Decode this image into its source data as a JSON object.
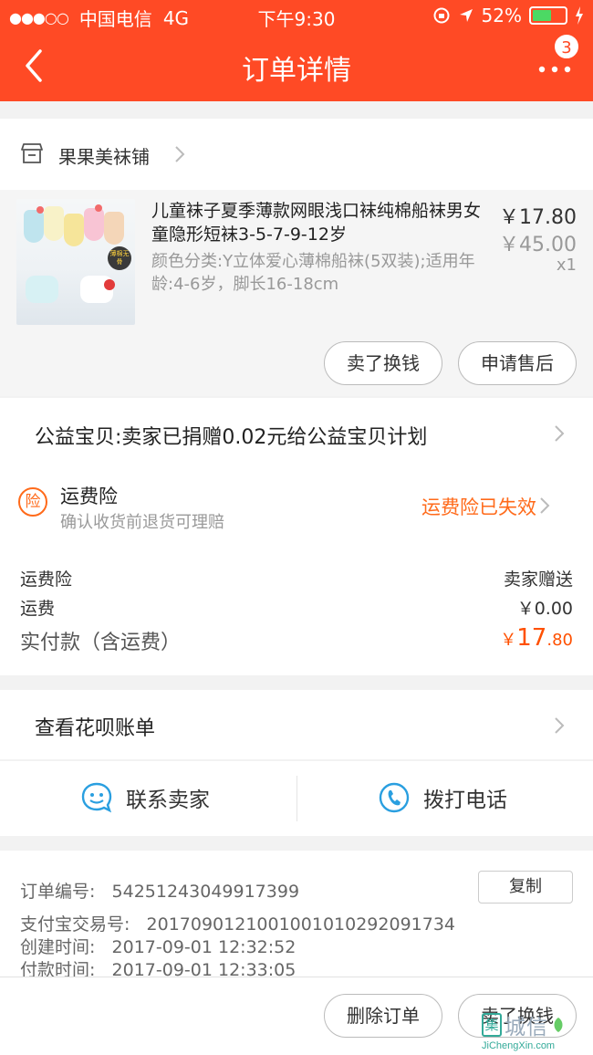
{
  "statusbar": {
    "carrier": "中国电信",
    "network": "4G",
    "time": "下午9:30",
    "battery": "52%"
  },
  "navbar": {
    "title": "订单详情",
    "badge": "3"
  },
  "shop": {
    "name": "果果美袜铺"
  },
  "product": {
    "title": "儿童袜子夏季薄款网眼浅口袜纯棉船袜男女童隐形短袜3-5-7-9-12岁",
    "spec": "颜色分类:Y立体爱心薄棉船袜(5双装);适用年龄:4-6岁，脚长16-18cm",
    "price": "￥17.80",
    "original_price": "￥45.00",
    "quantity": "x1",
    "thumb_tag": "薄棉无骨"
  },
  "actions": {
    "sell": "卖了换钱",
    "after_sale": "申请售后"
  },
  "charity": {
    "text": "公益宝贝:卖家已捐赠0.02元给公益宝贝计划"
  },
  "insurance": {
    "icon_char": "险",
    "title": "运费险",
    "subtitle": "确认收货前退货可理赔",
    "status": "运费险已失效"
  },
  "fees": {
    "ins_label": "运费险",
    "ins_value": "卖家赠送",
    "shipping_label": "运费",
    "shipping_value": "￥0.00",
    "paid_label": "实付款（含运费）",
    "paid_currency": "￥",
    "paid_int": "17",
    "paid_dec": ".80"
  },
  "huabei": {
    "text": "查看花呗账单"
  },
  "contact": {
    "seller": "联系卖家",
    "phone": "拨打电话"
  },
  "order": {
    "no_label": "订单编号:",
    "no_value": "54251243049917399",
    "copy": "复制",
    "alipay_label": "支付宝交易号:",
    "alipay_value": "2017090121001001010292091734",
    "created_label": "创建时间:",
    "created_value": "2017-09-01 12:32:52",
    "paid_label": "付款时间:",
    "paid_value": "2017-09-01 12:33:05"
  },
  "bottom": {
    "delete": "删除订单",
    "sell": "卖了换钱"
  },
  "watermark": {
    "mark": "集",
    "text": "城信",
    "sub": "JiChengXin.com"
  },
  "colors": {
    "brand": "#ff4a25",
    "accent": "#ff5000",
    "link_blue": "#2a9fe0"
  }
}
